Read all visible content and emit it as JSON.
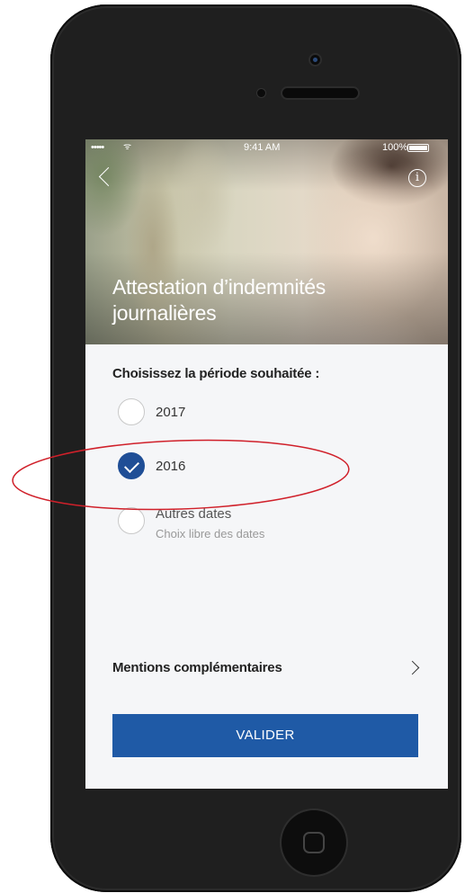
{
  "status_bar": {
    "signal": "•••••",
    "wifi": "ᯤ",
    "time": "9:41 AM",
    "battery_percent": "100%"
  },
  "header": {
    "back_icon": "chevron-left-icon",
    "info_icon": "info-circle-icon",
    "info_glyph": "i",
    "title": "Attestation d’indemnités journalières"
  },
  "form": {
    "period_label": "Choisissez la période souhaitée :",
    "options": [
      {
        "label": "2017",
        "selected": false
      },
      {
        "label": "2016",
        "selected": true
      },
      {
        "label": "Autres dates",
        "sublabel": "Choix libre des dates",
        "selected": false
      }
    ],
    "mentions_label": "Mentions complémentaires",
    "validate_label": "VALIDER"
  },
  "colors": {
    "accent": "#1f5aa6",
    "selected_radio": "#1f4e96",
    "highlight_annotation": "#d0202a",
    "phone_body": "#1f1f1f"
  }
}
